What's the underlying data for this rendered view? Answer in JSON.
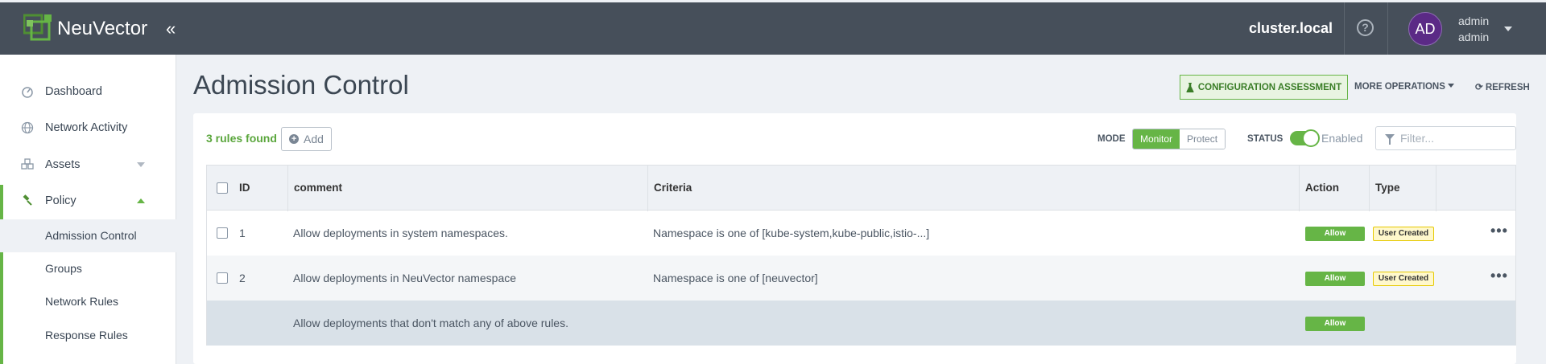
{
  "header": {
    "brand": "NeuVector",
    "collapse_glyph": "«",
    "cluster": "cluster.local",
    "help_glyph": "?",
    "avatar_initials": "AD",
    "user_name": "admin",
    "user_role": "admin"
  },
  "sidebar": {
    "items": [
      {
        "label": "Dashboard",
        "icon": "dashboard-icon"
      },
      {
        "label": "Network Activity",
        "icon": "globe-icon"
      },
      {
        "label": "Assets",
        "icon": "assets-icon"
      },
      {
        "label": "Policy",
        "icon": "gavel-icon"
      }
    ],
    "policy_sub": [
      {
        "label": "Admission Control"
      },
      {
        "label": "Groups"
      },
      {
        "label": "Network Rules"
      },
      {
        "label": "Response Rules"
      }
    ]
  },
  "page": {
    "title": "Admission Control",
    "config_btn": "CONFIGURATION ASSESSMENT",
    "more_ops": "MORE OPERATIONS",
    "refresh": "REFRESH"
  },
  "toolbar": {
    "count": "3 rules found",
    "add": "Add",
    "mode_label": "MODE",
    "mode_monitor": "Monitor",
    "mode_protect": "Protect",
    "status_label": "STATUS",
    "status_value": "Enabled",
    "filter_placeholder": "Filter..."
  },
  "table": {
    "headers": {
      "id": "ID",
      "comment": "comment",
      "criteria": "Criteria",
      "action": "Action",
      "type": "Type"
    },
    "rows": [
      {
        "id": "1",
        "comment": "Allow deployments in system namespaces.",
        "criteria": "Namespace is one of [kube-system,kube-public,istio-...]",
        "action": "Allow",
        "type": "User Created",
        "more": "•••"
      },
      {
        "id": "2",
        "comment": "Allow deployments in NeuVector namespace",
        "criteria": "Namespace is one of [neuvector]",
        "action": "Allow",
        "type": "User Created",
        "more": "•••"
      }
    ],
    "default_row": {
      "comment": "Allow deployments that don't match any of above rules.",
      "action": "Allow"
    }
  },
  "colors": {
    "accent_green": "#66b546",
    "header_bg": "#464f5a",
    "avatar_bg": "#5b2a86",
    "type_badge_bg": "#fff8cc"
  }
}
